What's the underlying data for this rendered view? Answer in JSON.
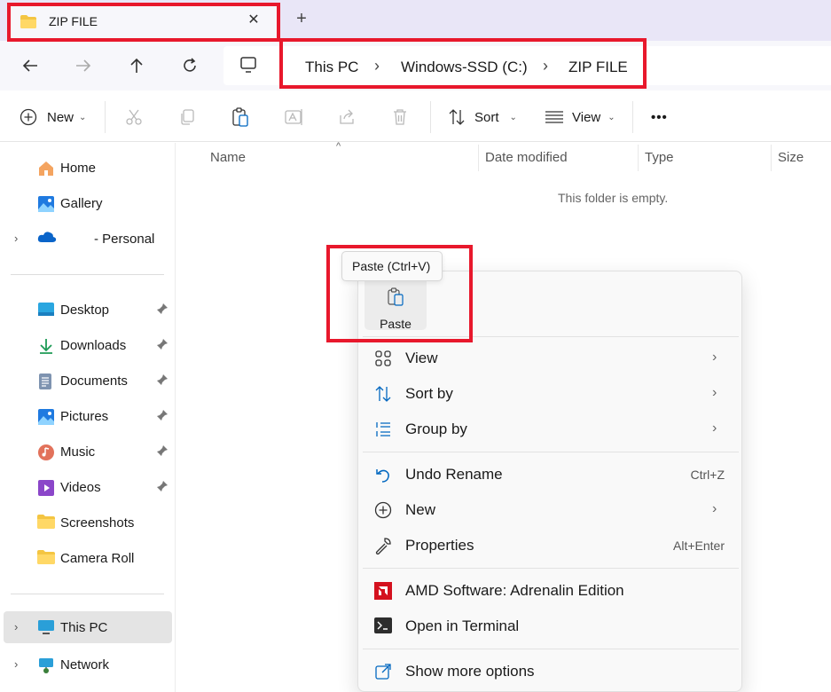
{
  "tab": {
    "title": "ZIP FILE",
    "close": "✕",
    "new": "+"
  },
  "address": {
    "crumbs": [
      "This PC",
      "Windows-SSD (C:)",
      "ZIP FILE"
    ],
    "sep": "›"
  },
  "commands": {
    "new": "New",
    "sort": "Sort",
    "view": "View",
    "more": "•••"
  },
  "sidebar": {
    "items": [
      {
        "label": "Home"
      },
      {
        "label": "Gallery"
      },
      {
        "label": "- Personal"
      },
      {
        "label": "Desktop"
      },
      {
        "label": "Downloads"
      },
      {
        "label": "Documents"
      },
      {
        "label": "Pictures"
      },
      {
        "label": "Music"
      },
      {
        "label": "Videos"
      },
      {
        "label": "Screenshots"
      },
      {
        "label": "Camera Roll"
      },
      {
        "label": "This PC"
      },
      {
        "label": "Network"
      }
    ]
  },
  "content": {
    "columns": [
      "Name",
      "Date modified",
      "Type",
      "Size"
    ],
    "empty_text": "This folder is empty."
  },
  "context_menu": {
    "tooltip": "Paste (Ctrl+V)",
    "paste_label": "Paste",
    "items": [
      {
        "label": "View"
      },
      {
        "label": "Sort by"
      },
      {
        "label": "Group by"
      },
      {
        "label": "Undo Rename",
        "shortcut": "Ctrl+Z"
      },
      {
        "label": "New"
      },
      {
        "label": "Properties",
        "shortcut": "Alt+Enter"
      },
      {
        "label": "AMD Software: Adrenalin Edition"
      },
      {
        "label": "Open in Terminal"
      },
      {
        "label": "Show more options"
      }
    ]
  },
  "colors": {
    "highlight": "#e8182c",
    "tabbar": "#e9e6f7",
    "accent": "#0067c0"
  }
}
